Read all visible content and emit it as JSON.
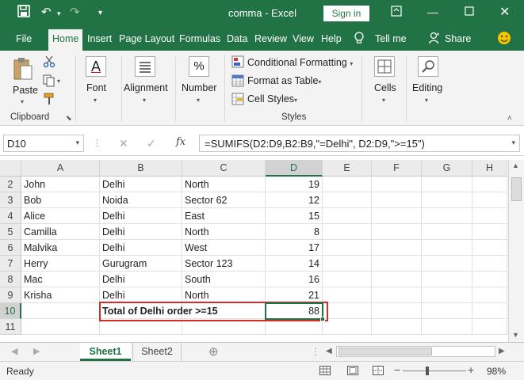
{
  "window": {
    "title": "comma  -  Excel",
    "sign_in": "Sign in"
  },
  "menu": {
    "tabs": [
      "File",
      "Home",
      "Insert",
      "Page Layout",
      "Formulas",
      "Data",
      "Review",
      "View",
      "Help",
      "Tell me",
      "Share"
    ]
  },
  "ribbon": {
    "paste": "Paste",
    "clipboard": "Clipboard",
    "font": "Font",
    "alignment": "Alignment",
    "number": "Number",
    "number_glyph": "%",
    "conditional_formatting": "Conditional Formatting",
    "format_as_table": "Format as Table",
    "cell_styles": "Cell Styles",
    "styles": "Styles",
    "cells": "Cells",
    "editing": "Editing",
    "font_glyph": "A"
  },
  "formula_bar": {
    "name_box": "D10",
    "fx": "fx",
    "formula": "=SUMIFS(D2:D9,B2:B9,\"=Delhi\", D2:D9,\">=15\")"
  },
  "columns": [
    "A",
    "B",
    "C",
    "D",
    "E",
    "F",
    "G",
    "H"
  ],
  "rows": [
    {
      "num": "2",
      "a": "John",
      "b": "Delhi",
      "c": "North",
      "d": "19"
    },
    {
      "num": "3",
      "a": "Bob",
      "b": "Noida",
      "c": "Sector 62",
      "d": "12"
    },
    {
      "num": "4",
      "a": "Alice",
      "b": "Delhi",
      "c": "East",
      "d": "15"
    },
    {
      "num": "5",
      "a": "Camilla",
      "b": "Delhi",
      "c": "North",
      "d": "8"
    },
    {
      "num": "6",
      "a": "Malvika",
      "b": "Delhi",
      "c": "West",
      "d": "17"
    },
    {
      "num": "7",
      "a": "Herry",
      "b": "Gurugram",
      "c": "Sector 123",
      "d": "14"
    },
    {
      "num": "8",
      "a": "Mac",
      "b": "Delhi",
      "c": "South",
      "d": "16"
    },
    {
      "num": "9",
      "a": "Krisha",
      "b": "Delhi",
      "c": "North",
      "d": "21"
    },
    {
      "num": "10",
      "a": "",
      "b": "Total of Delhi order >=15",
      "c": "",
      "d": "88"
    },
    {
      "num": "11",
      "a": "",
      "b": "",
      "c": "",
      "d": ""
    }
  ],
  "sheets": [
    "Sheet1",
    "Sheet2"
  ],
  "status": {
    "ready": "Ready",
    "zoom": "98%"
  },
  "colors": {
    "accent": "#217346",
    "highlight_border": "#d92b2b"
  }
}
